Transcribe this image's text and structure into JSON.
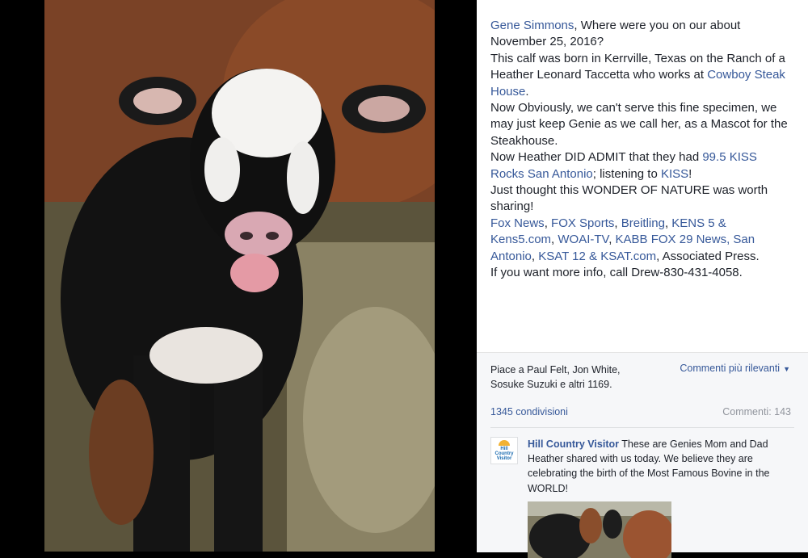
{
  "post": {
    "tag_gene": "Gene Simmons",
    "line1_rest": ", Where were you on our about November 25, 2016?",
    "line2": "This calf was born in Kerrville, Texas on the Ranch of a Heather Leonard Taccetta who works at",
    "link_cowboy": "Cowboy Steak House",
    "line3_end": ".",
    "line4": "Now Obviously, we can't serve this fine specimen, we may just keep Genie as we call her, as a Mascot for the Steakhouse.",
    "line5_start": "Now Heather DID ADMIT that they had ",
    "link_kiss_rocks": "99.5 KISS Rocks San Antonio",
    "line5_mid": "; listening to ",
    "link_kiss": "KISS",
    "line5_end": "!",
    "line6": "Just thought this WONDER OF NATURE was worth sharing!",
    "link_fox_news": "Fox News",
    "sep1": ", ",
    "link_fox_sports": "FOX Sports",
    "sep2": ", ",
    "link_breitling": "Breitling",
    "sep3": ", ",
    "link_kens": "KENS 5 & Kens5.com",
    "sep4": ", ",
    "link_woai": "WOAI-TV",
    "sep5": ", ",
    "link_kabb": "KABB FOX 29 News, San Antonio",
    "sep6": ", ",
    "link_ksat": "KSAT 12 & KSAT.com",
    "line7_end": ", Associated Press.",
    "line8": "If you want more info, call Drew-830-431-4058."
  },
  "footer": {
    "likes_text": "Piace a Paul Felt, Jon White, Sosuke Suzuki e altri 1169.",
    "sort_label": "Commenti più rilevanti",
    "shares": "1345 condivisioni",
    "comments": "Commenti: 143"
  },
  "comment": {
    "avatar_line1": "Hill",
    "avatar_line2": "Country",
    "avatar_line3": "Visitor",
    "author": "Hill Country Visitor",
    "text": " These are Genies Mom and Dad Heather shared with us today. We believe they are celebrating the birth of the Most Famous Bovine in the WORLD!"
  },
  "colors": {
    "link": "#365899",
    "text": "#1d2129",
    "muted": "#90949c",
    "footer_bg": "#f6f7f9"
  }
}
